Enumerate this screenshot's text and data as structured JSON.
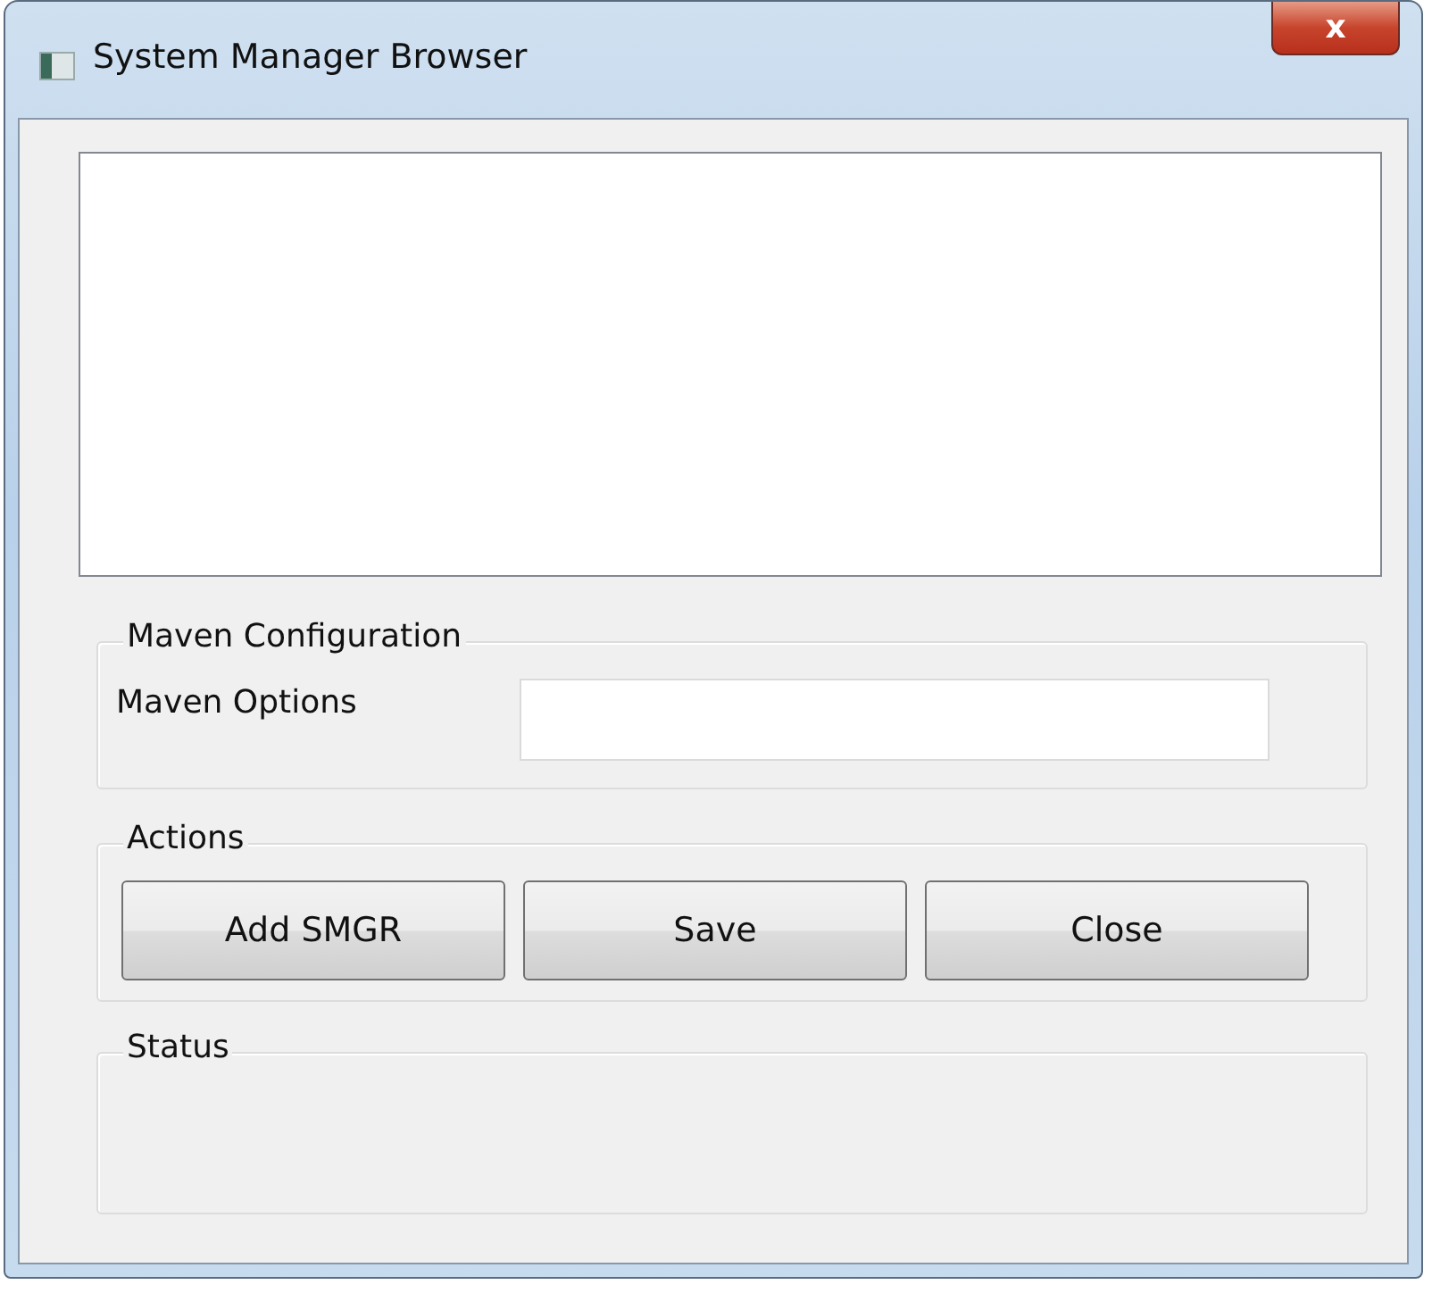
{
  "window": {
    "title": "System Manager Browser",
    "close_glyph": "x"
  },
  "maven_configuration": {
    "title": "Maven Configuration",
    "field_label": "Maven Options"
  },
  "actions": {
    "title": "Actions",
    "buttons": [
      "Add SMGR",
      "Save",
      "Close"
    ]
  },
  "status": {
    "title": "Status"
  }
}
